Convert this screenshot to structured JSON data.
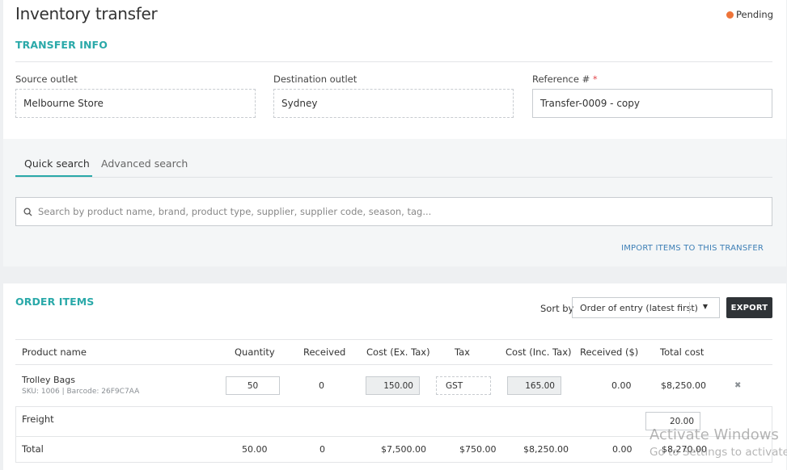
{
  "page": {
    "title": "Inventory transfer",
    "status": "Pending",
    "status_color": "#ee7439"
  },
  "transfer_info": {
    "heading": "TRANSFER INFO",
    "source_label": "Source outlet",
    "source_value": "Melbourne Store",
    "destination_label": "Destination outlet",
    "destination_value": "Sydney",
    "reference_label": "Reference #",
    "reference_required": "*",
    "reference_value": "Transfer-0009 - copy"
  },
  "search": {
    "tabs": [
      "Quick search",
      "Advanced search"
    ],
    "active_tab": "Quick search",
    "placeholder": "Search by product name, brand, product type, supplier, supplier code, season, tag...",
    "import_link": "IMPORT ITEMS TO THIS TRANSFER",
    "accent_color": "#2aa9a9"
  },
  "order_items": {
    "heading": "ORDER ITEMS",
    "sort_label": "Sort by",
    "sort_value": "Order of entry (latest first)",
    "export_label": "EXPORT",
    "columns": [
      "Product name",
      "Quantity",
      "Received",
      "Cost (Ex. Tax)",
      "Tax",
      "Cost (Inc. Tax)",
      "Received ($)",
      "Total cost"
    ],
    "rows": [
      {
        "name": "Trolley Bags",
        "sku_line": "SKU: 1006 | Barcode: 26F9C7AA",
        "quantity": "50",
        "received": "0",
        "cost_ex_tax": "150.00",
        "tax": "GST",
        "cost_inc_tax": "165.00",
        "received_dollars": "0.00",
        "total_cost": "$8,250.00",
        "remove_icon": "x-icon"
      }
    ],
    "freight": {
      "label": "Freight",
      "value": "20.00"
    },
    "total": {
      "label": "Total",
      "quantity": "50.00",
      "received": "0",
      "cost_ex_tax": "$7,500.00",
      "tax": "$750.00",
      "cost_inc_tax": "$8,250.00",
      "received_dollars": "0.00",
      "total_cost": "$8,270.00"
    }
  },
  "watermark": {
    "line1": "Activate Windows",
    "line2": "Go to Settings to activate"
  }
}
